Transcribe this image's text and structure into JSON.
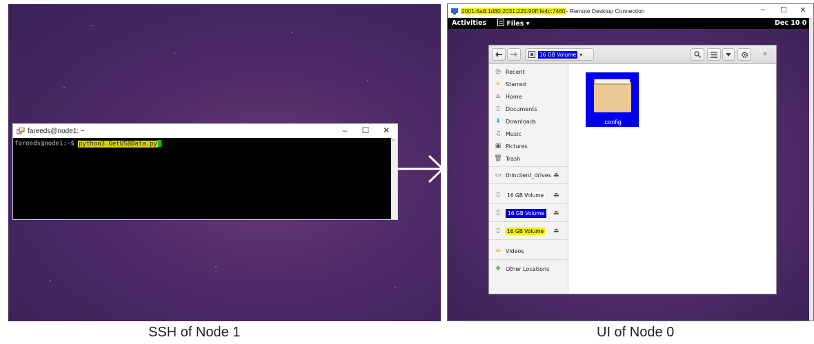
{
  "ssh": {
    "window_title": "fareeds@node1: ~",
    "prompt": "fareeds@node1:~$ ",
    "command": "python3 GetUSBData.py",
    "controls": {
      "minimize": "–",
      "maximize": "☐",
      "close": "✕"
    },
    "scroll_up": "^"
  },
  "rdp": {
    "address": "2001:6a8:1d80:2031:225:90ff:fe4c:7460",
    "window_title_suffix": " - Remote Desktop Connection",
    "controls": {
      "minimize": "–",
      "maximize": "☐",
      "close": "✕"
    },
    "topbar": {
      "activities": "Activities",
      "files_menu": "Files ▾",
      "clock": "Dec 10 0"
    }
  },
  "files": {
    "path_label": "16 GB Volume",
    "sidebar": {
      "recent": "Recent",
      "starred": "Starred",
      "home": "Home",
      "documents": "Documents",
      "downloads": "Downloads",
      "music": "Music",
      "pictures": "Pictures",
      "trash": "Trash",
      "thinclient": "thinclient_drives",
      "volume1": "16 GB Volume",
      "volume2": "16 GB Volume",
      "volume3": "16 GB Volume",
      "videos": "Videos",
      "other_locations": "Other Locations"
    },
    "folder": ".config"
  },
  "captions": {
    "left": "SSH of Node 1",
    "right": "UI of Node 0"
  },
  "colors": {
    "desktop_purple": "#4d2a66",
    "highlight_yellow": "#f0f000",
    "highlight_blue": "#0000ee",
    "cursor_green": "#00cc00"
  }
}
